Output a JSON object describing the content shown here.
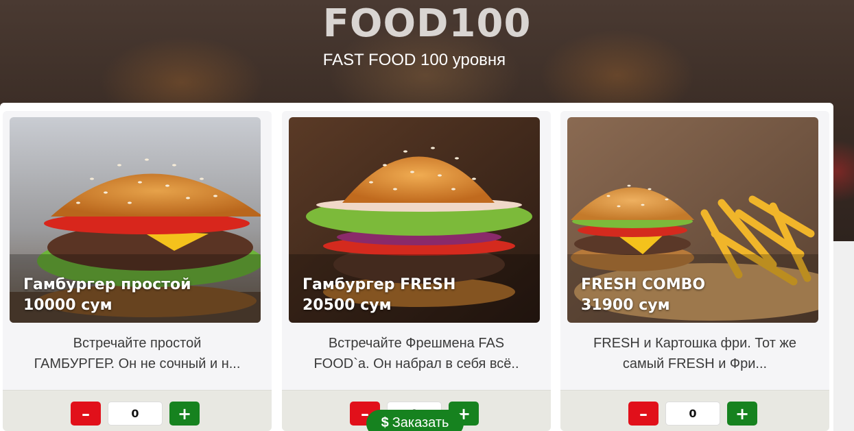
{
  "header": {
    "title": "FOOD100",
    "subtitle": "FAST FOOD 100 уровня"
  },
  "products": [
    {
      "name": "Гамбургер простой",
      "price": "10000 сум",
      "desc_line1": "Встречайте простой",
      "desc_line2": "ГАМБУРГЕР. Он не сочный и н...",
      "qty": "0",
      "minus_label": "–",
      "plus_label": "+"
    },
    {
      "name": "Гамбургер FRESH",
      "price": "20500 сум",
      "desc_line1": "Встречайте Фрешмена FAS",
      "desc_line2": "FOOD`а. Он набрал в себя всё..",
      "qty": "0",
      "minus_label": "–",
      "plus_label": "+"
    },
    {
      "name": "FRESH COMBO",
      "price": "31900 сум",
      "desc_line1": "FRESH и Картошка фри. Тот же",
      "desc_line2": "самый FRESH и Фри...",
      "qty": "0",
      "minus_label": "–",
      "plus_label": "+"
    }
  ],
  "order_button": {
    "icon": "$",
    "label": "Заказать"
  },
  "colors": {
    "minus": "#e1101a",
    "plus": "#16821f",
    "order": "#16821f"
  }
}
